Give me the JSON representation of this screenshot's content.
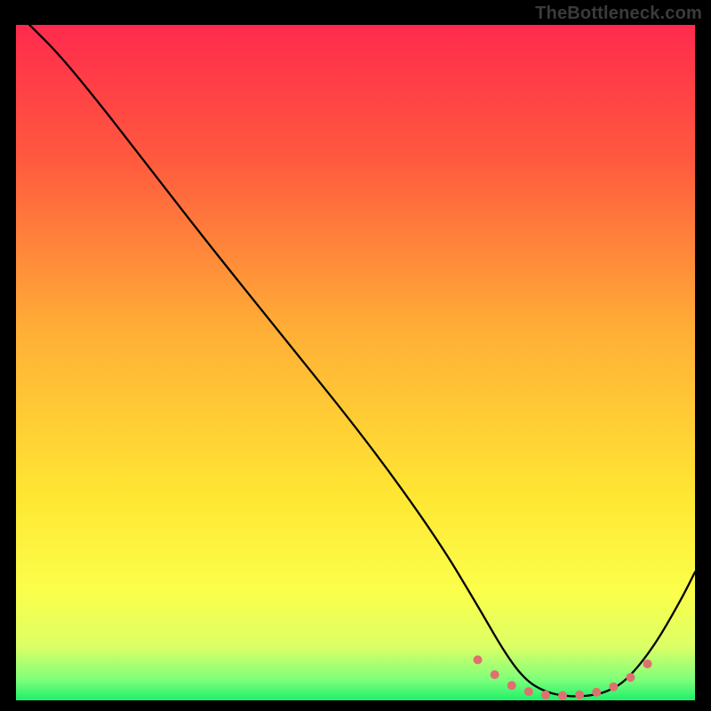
{
  "watermark": "TheBottleneck.com",
  "chart_data": {
    "type": "line",
    "title": "",
    "xlabel": "",
    "ylabel": "",
    "xlim": [
      0,
      100
    ],
    "ylim": [
      0,
      100
    ],
    "grid": false,
    "legend": false,
    "background_gradient": {
      "stops": [
        {
          "offset": 0.0,
          "color": "#ff2a4d"
        },
        {
          "offset": 0.2,
          "color": "#ff5a3e"
        },
        {
          "offset": 0.45,
          "color": "#ffae36"
        },
        {
          "offset": 0.7,
          "color": "#ffe733"
        },
        {
          "offset": 0.84,
          "color": "#fbff4b"
        },
        {
          "offset": 0.92,
          "color": "#dcff66"
        },
        {
          "offset": 0.97,
          "color": "#7dff7a"
        },
        {
          "offset": 1.0,
          "color": "#1df06a"
        }
      ]
    },
    "series": [
      {
        "name": "bottleneck-curve",
        "color": "#000000",
        "x": [
          2,
          6,
          11,
          18,
          28,
          40,
          52,
          62,
          68,
          72,
          75,
          78,
          81,
          84,
          87,
          90,
          94,
          98,
          100
        ],
        "y": [
          100,
          96,
          90,
          81,
          68,
          53,
          38,
          24,
          14,
          7,
          3,
          1.2,
          0.6,
          0.6,
          1.2,
          3,
          8,
          15,
          19
        ]
      }
    ],
    "dotted_overlay": {
      "name": "valley-dots",
      "color": "#e07070",
      "radius_px": 5,
      "x": [
        68,
        70.5,
        73,
        75.5,
        78,
        80.5,
        83,
        85.5,
        88,
        90.5,
        93
      ],
      "y": [
        6.0,
        3.8,
        2.2,
        1.3,
        0.8,
        0.7,
        0.8,
        1.2,
        2.0,
        3.4,
        5.4
      ]
    }
  }
}
